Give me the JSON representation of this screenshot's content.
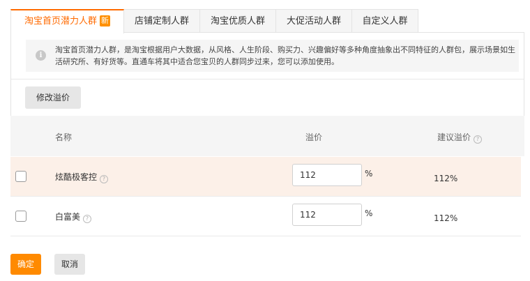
{
  "tabs": [
    {
      "label": "淘宝首页潜力人群",
      "badge": "新",
      "active": true
    },
    {
      "label": "店铺定制人群"
    },
    {
      "label": "淘宝优质人群"
    },
    {
      "label": "大促活动人群"
    },
    {
      "label": "自定义人群"
    }
  ],
  "info": {
    "text": "淘宝首页潜力人群，是淘宝根据用户大数据，从风格、人生阶段、购买力、兴趣偏好等多种角度抽象出不同特征的人群包，展示场景如生活研究所、有好货等。直通车将其中适合您宝贝的人群同步过来，您可以添加使用。"
  },
  "toolbar": {
    "edit_premium_label": "修改溢价"
  },
  "table": {
    "headers": {
      "name": "名称",
      "premium": "溢价",
      "suggested": "建议溢价"
    },
    "rows": [
      {
        "name": "炫酷极客控",
        "premium": "112",
        "unit": "%",
        "suggested": "112%",
        "checked": false
      },
      {
        "name": "白富美",
        "premium": "112",
        "unit": "%",
        "suggested": "112%",
        "checked": false
      }
    ]
  },
  "footer": {
    "confirm_label": "确定",
    "cancel_label": "取消"
  },
  "colors": {
    "accent": "#ff6a00",
    "confirm_button": "#ff8a00",
    "highlight_row": "#fcf0e8"
  }
}
